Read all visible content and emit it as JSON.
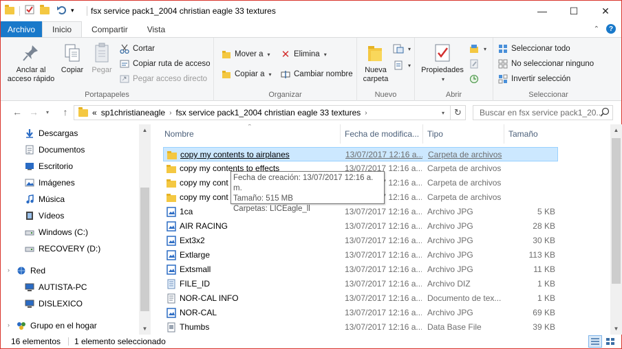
{
  "window": {
    "title": "fsx service pack1_2004 christian eagle 33 textures",
    "controls": {
      "minimize": "—",
      "maximize": "☐",
      "close": "✕"
    }
  },
  "ribbon_tabs": [
    "Archivo",
    "Inicio",
    "Compartir",
    "Vista"
  ],
  "ribbon": {
    "portapapeles": {
      "label": "Portapapeles",
      "pin": "Anclar al acceso rápido",
      "copy": "Copiar",
      "paste": "Pegar",
      "cut": "Cortar",
      "copy_path": "Copiar ruta de acceso",
      "paste_shortcut": "Pegar acceso directo"
    },
    "organizar": {
      "label": "Organizar",
      "move_to": "Mover a",
      "copy_to": "Copiar a",
      "delete": "Elimina",
      "rename": "Cambiar nombre"
    },
    "nuevo": {
      "label": "Nuevo",
      "new_folder": "Nueva carpeta"
    },
    "abrir": {
      "label": "Abrir",
      "properties": "Propiedades"
    },
    "seleccionar": {
      "label": "Seleccionar",
      "select_all": "Seleccionar todo",
      "select_none": "No seleccionar ninguno",
      "invert": "Invertir selección"
    }
  },
  "address": {
    "overflow": "«",
    "crumbs": [
      "sp1christianeagle",
      "fsx service pack1_2004 christian eagle 33 textures"
    ],
    "search_placeholder": "Buscar en fsx service pack1_20..."
  },
  "nav_pane": [
    {
      "label": "Descargas",
      "icon": "download-arrow-icon"
    },
    {
      "label": "Documentos",
      "icon": "document-icon"
    },
    {
      "label": "Escritorio",
      "icon": "desktop-icon"
    },
    {
      "label": "Imágenes",
      "icon": "pictures-icon"
    },
    {
      "label": "Música",
      "icon": "music-note-icon"
    },
    {
      "label": "Vídeos",
      "icon": "video-film-icon"
    },
    {
      "label": "Windows (C:)",
      "icon": "drive-icon"
    },
    {
      "label": "RECOVERY (D:)",
      "icon": "drive-icon"
    },
    {
      "label": "Red",
      "icon": "network-icon"
    },
    {
      "label": "AUTISTA-PC",
      "icon": "computer-icon"
    },
    {
      "label": "DISLEXICO",
      "icon": "computer-icon"
    },
    {
      "label": "Grupo en el hogar",
      "icon": "homegroup-icon"
    }
  ],
  "columns": {
    "name": "Nombre",
    "date": "Fecha de modifica...",
    "type": "Tipo",
    "size": "Tamaño"
  },
  "files": [
    {
      "name": "copy my contents to airplanes",
      "date": "13/07/2017 12:16 a....",
      "type": "Carpeta de archivos",
      "size": "",
      "kind": "folder"
    },
    {
      "name": "copy my contents to effects",
      "date": "13/07/2017 12:16 a....",
      "type": "Carpeta de archivos",
      "size": "",
      "kind": "folder"
    },
    {
      "name": "copy my cont",
      "date": "13/07/2017 12:16 a....",
      "type": "Carpeta de archivos",
      "size": "",
      "kind": "folder"
    },
    {
      "name": "copy my cont",
      "date": "13/07/2017 12:16 a....",
      "type": "Carpeta de archivos",
      "size": "",
      "kind": "folder"
    },
    {
      "name": "1ca",
      "date": "13/07/2017 12:16 a....",
      "type": "Archivo JPG",
      "size": "5 KB",
      "kind": "jpg"
    },
    {
      "name": "AIR RACING",
      "date": "13/07/2017 12:16 a....",
      "type": "Archivo JPG",
      "size": "28 KB",
      "kind": "jpg"
    },
    {
      "name": "Ext3x2",
      "date": "13/07/2017 12:16 a....",
      "type": "Archivo JPG",
      "size": "30 KB",
      "kind": "jpg"
    },
    {
      "name": "Extlarge",
      "date": "13/07/2017 12:16 a....",
      "type": "Archivo JPG",
      "size": "113 KB",
      "kind": "jpg"
    },
    {
      "name": "Extsmall",
      "date": "13/07/2017 12:16 a....",
      "type": "Archivo JPG",
      "size": "11 KB",
      "kind": "jpg"
    },
    {
      "name": "FILE_ID",
      "date": "13/07/2017 12:16 a....",
      "type": "Archivo DIZ",
      "size": "1 KB",
      "kind": "diz"
    },
    {
      "name": "NOR-CAL INFO",
      "date": "13/07/2017 12:16 a....",
      "type": "Documento de tex...",
      "size": "1 KB",
      "kind": "txt"
    },
    {
      "name": "NOR-CAL",
      "date": "13/07/2017 12:16 a....",
      "type": "Archivo JPG",
      "size": "69 KB",
      "kind": "jpg"
    },
    {
      "name": "Thumbs",
      "date": "13/07/2017 12:16 a....",
      "type": "Data Base File",
      "size": "39 KB",
      "kind": "db"
    }
  ],
  "tooltip": {
    "line1": "Fecha de creación: 13/07/2017 12:16 a. m.",
    "line2": "Tamaño: 515 MB",
    "line3": "Carpetas: LICEagle_ll"
  },
  "status": {
    "count": "16 elementos",
    "selection": "1 elemento seleccionado"
  },
  "colors": {
    "accent": "#1979ca",
    "selection": "#cce8ff",
    "window_border": "#d9342b"
  }
}
